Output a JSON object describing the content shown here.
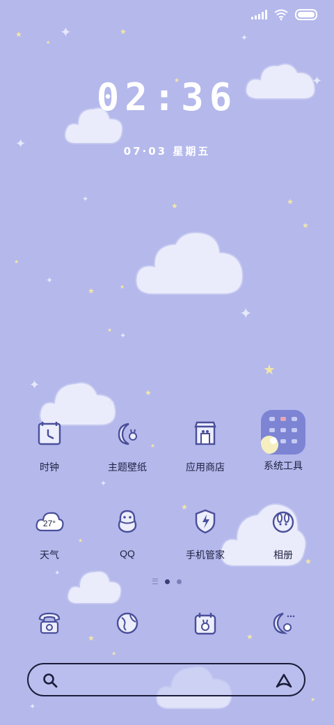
{
  "status_bar": {
    "signal_icon": "signal-bars-icon",
    "wifi_icon": "wifi-icon",
    "battery_icon": "battery-icon"
  },
  "lockclock": {
    "time": "02:36",
    "date": "07·03 星期五"
  },
  "apps_row1": [
    {
      "label": "时钟",
      "icon": "clock-icon"
    },
    {
      "label": "主题壁纸",
      "icon": "moon-bunny-icon"
    },
    {
      "label": "应用商店",
      "icon": "store-icon"
    },
    {
      "label": "系统工具",
      "icon": "folder-icon"
    }
  ],
  "apps_row2": [
    {
      "label": "天气",
      "icon": "weather-cloud-icon",
      "temp": "27°"
    },
    {
      "label": "QQ",
      "icon": "penguin-icon"
    },
    {
      "label": "手机管家",
      "icon": "shield-icon"
    },
    {
      "label": "相册",
      "icon": "bunny-face-icon"
    }
  ],
  "dock": [
    {
      "icon": "phone-icon"
    },
    {
      "icon": "browser-globe-icon"
    },
    {
      "icon": "calendar-bunny-icon"
    },
    {
      "icon": "moon-message-icon"
    }
  ],
  "pager": {
    "pages": 2,
    "active_page": 1
  },
  "search": {
    "search_icon": "search-icon",
    "assistant_icon": "assistant-a-icon"
  },
  "colors": {
    "background": "#b4b8eb",
    "cloud": "#eaecfb",
    "icon_stroke": "#4a4f9a",
    "folder": "#7d84d4"
  }
}
